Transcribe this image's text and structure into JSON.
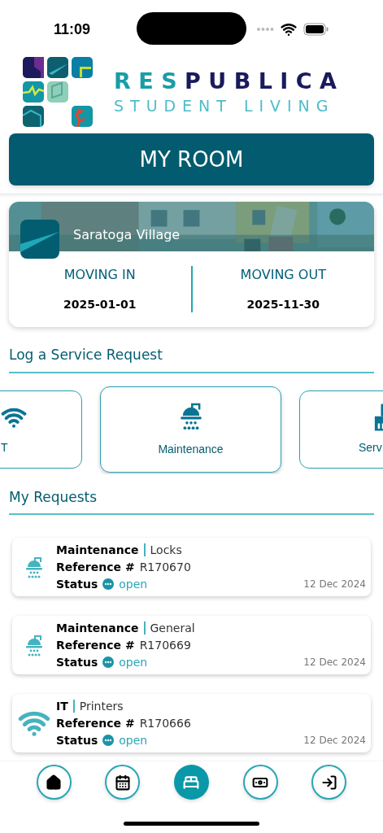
{
  "status_bar": {
    "time": "11:09"
  },
  "logo": {
    "brand_start": "RES",
    "brand_end": "PUBLICA",
    "tagline": "STUDENT LIVING"
  },
  "page_title": "MY ROOM",
  "residence": {
    "name": "Saratoga Village",
    "moving_in_label": "MOVING IN",
    "moving_in": "2025-01-01",
    "moving_out_label": "MOVING OUT",
    "moving_out": "2025-11-30"
  },
  "service_section": {
    "title": "Log a Service Request",
    "categories": [
      {
        "label": "T",
        "kind": "it",
        "selected": false
      },
      {
        "label": "Maintenance",
        "kind": "maintenance",
        "selected": true
      },
      {
        "label": "Serv",
        "kind": "cleaning",
        "selected": false
      }
    ]
  },
  "requests_section": {
    "title": "My Requests",
    "requests": [
      {
        "kind": "maintenance",
        "category": "Maintenance",
        "subcategory": "Locks",
        "reference_label": "Reference #",
        "reference": "R170670",
        "status_label": "Status",
        "status": "open",
        "date": "12 Dec 2024"
      },
      {
        "kind": "maintenance",
        "category": "Maintenance",
        "subcategory": "General",
        "reference_label": "Reference #",
        "reference": "R170669",
        "status_label": "Status",
        "status": "open",
        "date": "12 Dec 2024"
      },
      {
        "kind": "it",
        "category": "IT",
        "subcategory": "Printers",
        "reference_label": "Reference #",
        "reference": "R170666",
        "status_label": "Status",
        "status": "open",
        "date": "12 Dec 2024"
      }
    ]
  },
  "bottom_nav": [
    {
      "kind": "home",
      "selected": false
    },
    {
      "kind": "calendar",
      "selected": false
    },
    {
      "kind": "bed",
      "selected": true
    },
    {
      "kind": "cash",
      "selected": false
    },
    {
      "kind": "logout",
      "selected": false
    }
  ]
}
